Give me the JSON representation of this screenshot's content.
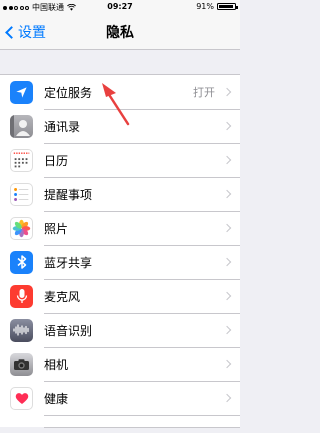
{
  "status_bar": {
    "carrier": "中国联通",
    "time": "09:27",
    "battery": "91%"
  },
  "nav": {
    "back_label": "设置",
    "title": "隐私"
  },
  "rows": [
    {
      "label": "定位服务",
      "value": "打开",
      "icon": "location-arrow-icon",
      "color": "#1a82fb"
    },
    {
      "label": "通讯录",
      "value": "",
      "icon": "contacts-icon",
      "color": "#8e8e93"
    },
    {
      "label": "日历",
      "value": "",
      "icon": "calendar-icon",
      "color": "#ffffff"
    },
    {
      "label": "提醒事项",
      "value": "",
      "icon": "reminders-icon",
      "color": "#ffffff"
    },
    {
      "label": "照片",
      "value": "",
      "icon": "photos-icon",
      "color": "#ffffff"
    },
    {
      "label": "蓝牙共享",
      "value": "",
      "icon": "bluetooth-icon",
      "color": "#1a82fb"
    },
    {
      "label": "麦克风",
      "value": "",
      "icon": "microphone-icon",
      "color": "#fd3b30"
    },
    {
      "label": "语音识别",
      "value": "",
      "icon": "speech-waveform-icon",
      "color": "#5f6377"
    },
    {
      "label": "相机",
      "value": "",
      "icon": "camera-icon",
      "color": "#8e8e93"
    },
    {
      "label": "健康",
      "value": "",
      "icon": "health-heart-icon",
      "color": "#ffffff"
    }
  ],
  "annotation": {
    "color": "#e8403f"
  }
}
